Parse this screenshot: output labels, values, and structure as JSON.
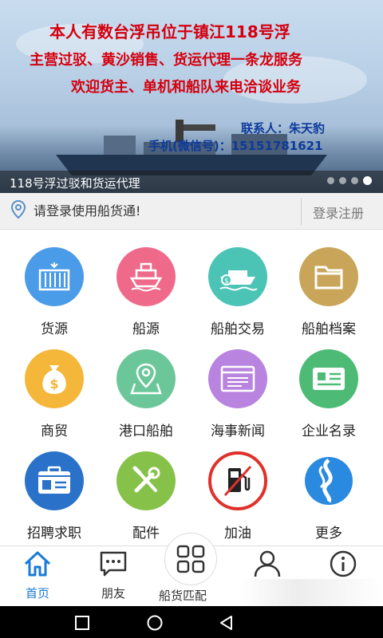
{
  "banner": {
    "lines": [
      "本人有数台浮吊位于镇江118号浮",
      "主营过驳、黄沙销售、货运代理一条龙服务",
      "欢迎货主、单机和船队来电洽谈业务",
      "联系人：朱天豹",
      "手机(微信号)：15151781621"
    ],
    "caption": "118号浮过驳和货运代理",
    "dots_total": 4,
    "active_dot": 4
  },
  "login": {
    "hint": "请登录使用船货通!",
    "button": "登录注册",
    "icon": "location-pin-icon"
  },
  "grid": {
    "items": [
      {
        "label": "货源",
        "icon": "container-icon",
        "color": "#4a9be8"
      },
      {
        "label": "船源",
        "icon": "ship-icon",
        "color": "#ef6a8a"
      },
      {
        "label": "船舶交易",
        "icon": "money-ship-icon",
        "color": "#4bc4b6"
      },
      {
        "label": "船舶档案",
        "icon": "folder-icon",
        "color": "#c9a55a"
      },
      {
        "label": "商贸",
        "icon": "money-bag-icon",
        "color": "#f4b73a"
      },
      {
        "label": "港口船舶",
        "icon": "map-pin-icon",
        "color": "#6bc79a"
      },
      {
        "label": "海事新闻",
        "icon": "browser-window-icon",
        "color": "#b884e0"
      },
      {
        "label": "企业名录",
        "icon": "business-card-icon",
        "color": "#4dbb76"
      },
      {
        "label": "招聘求职",
        "icon": "id-card-icon",
        "color": "#2a72c9"
      },
      {
        "label": "配件",
        "icon": "tools-icon",
        "color": "#86c24a"
      },
      {
        "label": "加油",
        "icon": "fuel-pump-icon",
        "color": "#e0302a"
      },
      {
        "label": "更多",
        "icon": "swirl-logo-icon",
        "color": "#2a8ae0"
      }
    ]
  },
  "bottom_nav": {
    "items": [
      {
        "label": "首页",
        "icon": "home-icon",
        "active": true
      },
      {
        "label": "朋友",
        "icon": "chat-bubble-icon",
        "active": false
      },
      {
        "label": "船货匹配",
        "icon": "grid-four-icon",
        "active": false
      },
      {
        "label": "",
        "icon": "person-icon",
        "active": false
      },
      {
        "label": "",
        "icon": "info-icon",
        "active": false
      }
    ]
  },
  "colors": {
    "accent": "#1a7bd6",
    "banner_red": "#d4000f",
    "banner_blue": "#0d3a9a"
  }
}
